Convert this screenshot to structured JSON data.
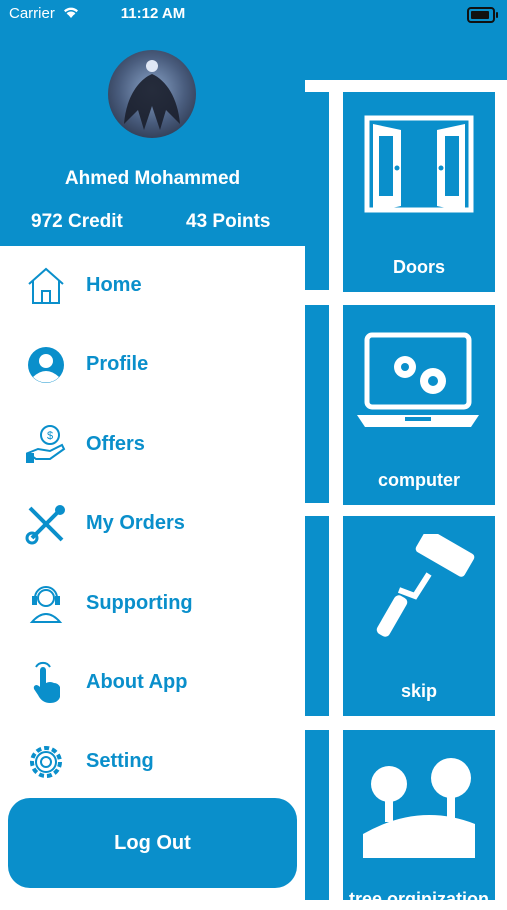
{
  "status_bar": {
    "carrier": "Carrier",
    "time": "11:12 AM"
  },
  "user": {
    "name": "Ahmed Mohammed",
    "credit": "972 Credit",
    "points": "43 Points"
  },
  "menu": [
    {
      "label": "Home",
      "icon": "home-icon"
    },
    {
      "label": "Profile",
      "icon": "profile-icon"
    },
    {
      "label": "Offers",
      "icon": "offers-icon"
    },
    {
      "label": "My Orders",
      "icon": "orders-icon"
    },
    {
      "label": "Supporting",
      "icon": "support-icon"
    },
    {
      "label": "About App",
      "icon": "about-icon"
    },
    {
      "label": "Setting",
      "icon": "gear-icon"
    }
  ],
  "logout_label": "Log Out",
  "services": [
    {
      "label": "Doors",
      "icon": "doors-icon"
    },
    {
      "label": "computer",
      "icon": "computer-icon"
    },
    {
      "label": "skip",
      "icon": "paint-roller-icon"
    },
    {
      "label": "tree orginization",
      "icon": "trees-icon"
    }
  ],
  "colors": {
    "brand": "#0a8fcb",
    "white": "#ffffff"
  }
}
